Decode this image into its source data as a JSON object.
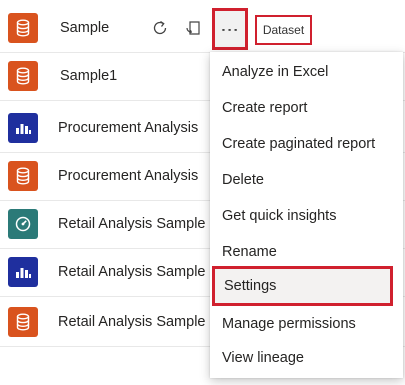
{
  "colors": {
    "dataset_orange": "#d9531e",
    "report_navy": "#1f2f9e",
    "dashboard_teal": "#2b7a78",
    "highlight_red": "#d0202e"
  },
  "rows": [
    {
      "name": "Sample",
      "icon": "dataset-icon"
    },
    {
      "name": "Sample1",
      "icon": "dataset-icon"
    },
    {
      "name": "Procurement Analysis",
      "icon": "report-icon"
    },
    {
      "name": "Procurement Analysis",
      "icon": "dataset-icon"
    },
    {
      "name": "Retail Analysis Sample",
      "icon": "dashboard-icon"
    },
    {
      "name": "Retail Analysis Sample",
      "icon": "report-icon"
    },
    {
      "name": "Retail Analysis Sample",
      "icon": "dataset-icon"
    }
  ],
  "row_actions": {
    "refresh_icon": "refresh-icon",
    "schedule_icon": "schedule-refresh-icon",
    "more_icon": "more-options-icon",
    "more_glyph": "⋮"
  },
  "type_badge": "Dataset",
  "menu": {
    "items": [
      {
        "label": "Analyze in Excel"
      },
      {
        "label": "Create report"
      },
      {
        "label": "Create paginated report"
      },
      {
        "label": "Delete"
      },
      {
        "label": "Get quick insights"
      },
      {
        "label": "Rename"
      },
      {
        "label": "Settings",
        "highlighted": true
      },
      {
        "label": "Manage permissions"
      },
      {
        "label": "View lineage"
      }
    ]
  }
}
